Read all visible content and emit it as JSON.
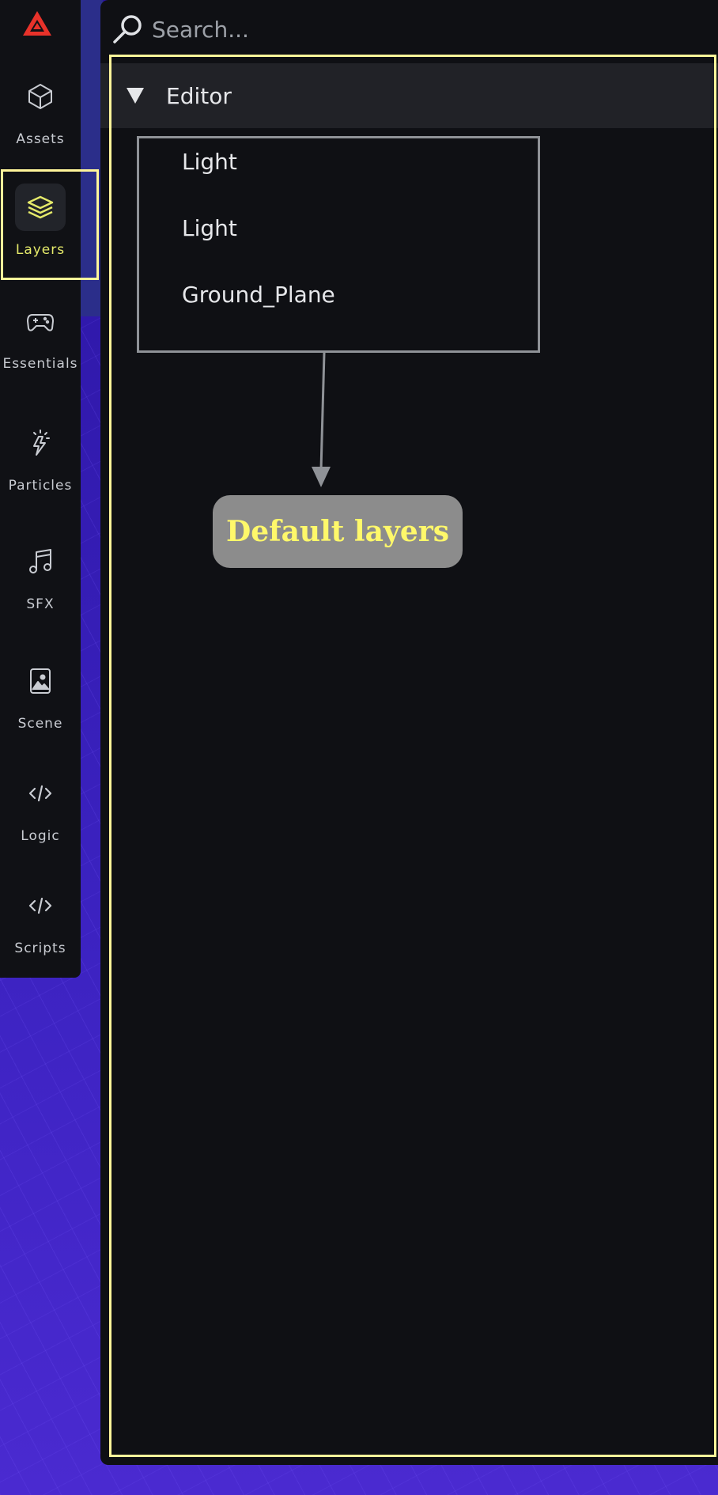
{
  "sidebar": {
    "logo_icon": "triangle-logo-icon",
    "items": [
      {
        "label": "Assets",
        "icon": "cube-icon"
      },
      {
        "label": "Layers",
        "icon": "layers-icon",
        "active": true
      },
      {
        "label": "Essentials",
        "icon": "gamepad-icon"
      },
      {
        "label": "Particles",
        "icon": "sparkle-bolt-icon"
      },
      {
        "label": "SFX",
        "icon": "music-note-icon"
      },
      {
        "label": "Scene",
        "icon": "image-icon"
      },
      {
        "label": "Logic",
        "icon": "code-icon"
      },
      {
        "label": "Scripts",
        "icon": "code-icon"
      }
    ]
  },
  "search": {
    "placeholder": "Search...",
    "value": ""
  },
  "layers_panel": {
    "section_title": "Editor",
    "items": [
      "Light",
      "Light",
      "Ground_Plane"
    ]
  },
  "annotation": {
    "callout_text": "Default layers"
  },
  "colors": {
    "accent": "#e5ea6a",
    "highlight": "#fff59a",
    "logo": "#e8322a",
    "panel": "#0f1014"
  }
}
